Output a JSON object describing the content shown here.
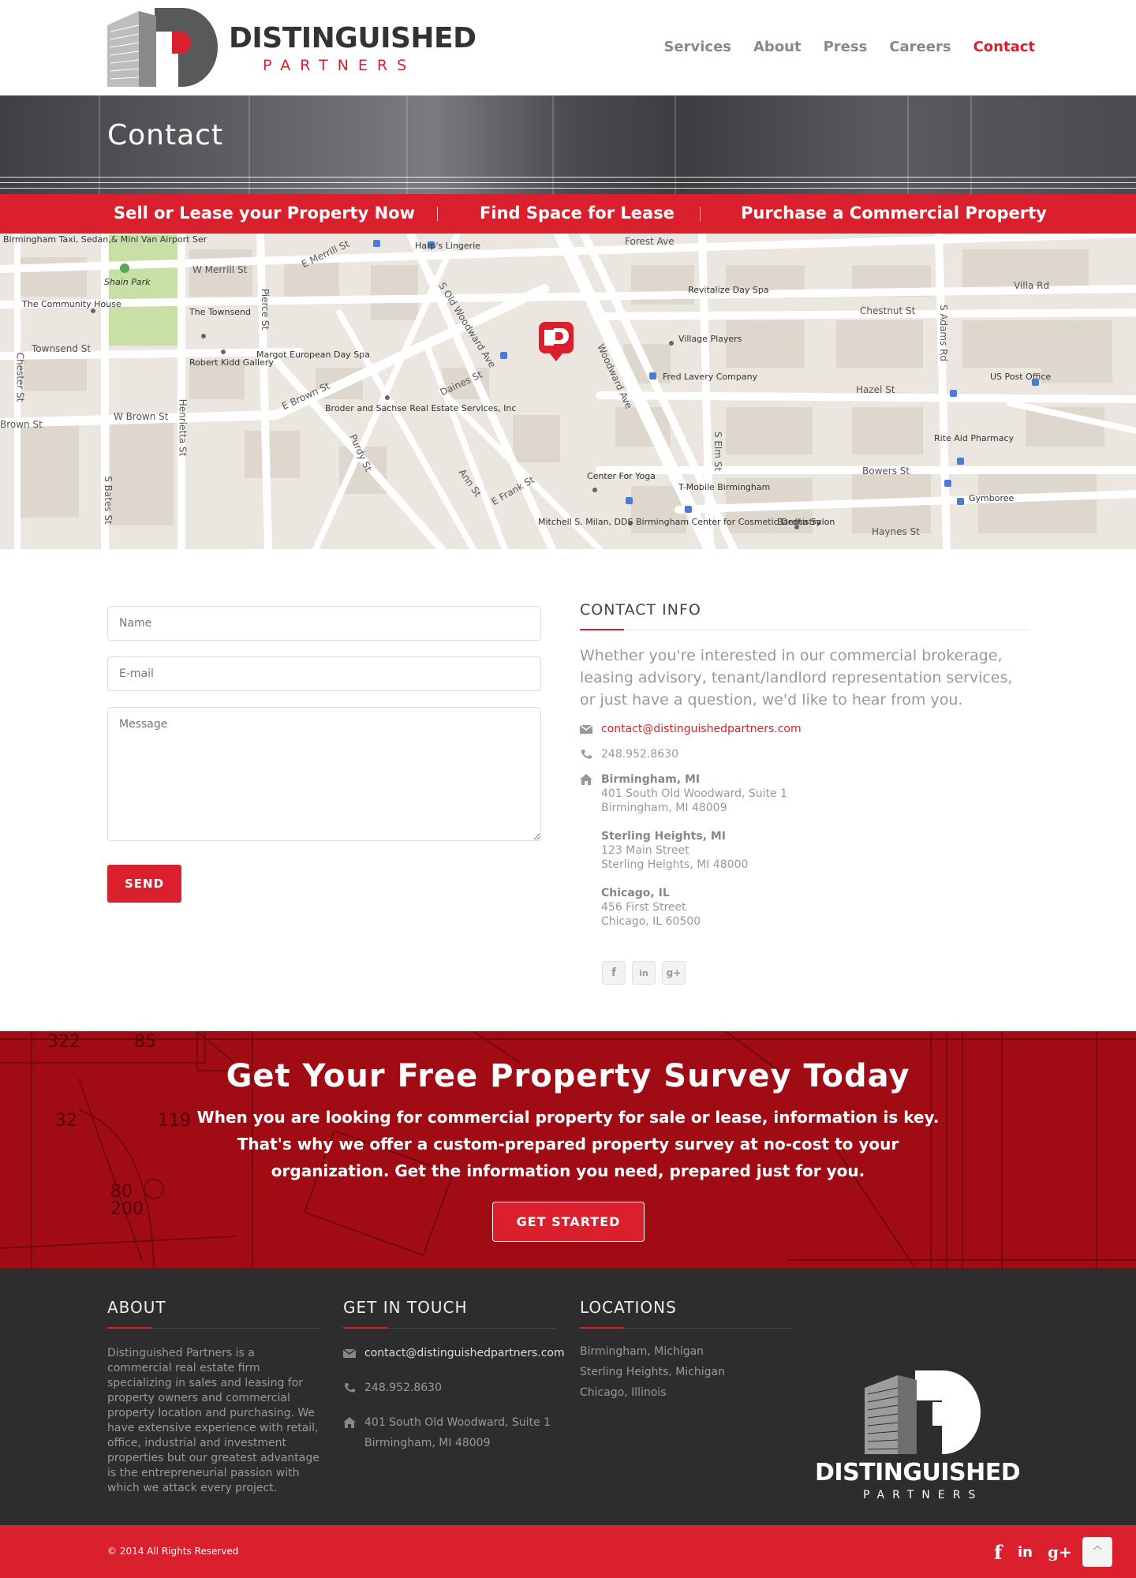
{
  "brand": {
    "name_line1": "DISTINGUISHED",
    "name_line2": "PARTNERS",
    "accent_color": "#d9202c",
    "dark_color": "#2d2d2e"
  },
  "nav": {
    "items": [
      {
        "label": "Services",
        "active": false
      },
      {
        "label": "About",
        "active": false
      },
      {
        "label": "Press",
        "active": false
      },
      {
        "label": "Careers",
        "active": false
      },
      {
        "label": "Contact",
        "active": true
      }
    ]
  },
  "hero": {
    "title": "Contact"
  },
  "redbar": {
    "items": [
      "Sell or Lease your Property Now",
      "Find Space for Lease",
      "Purchase a Commercial Property"
    ]
  },
  "map": {
    "labels": {
      "birmingham_taxi": "Birmingham Taxi, Sedan,& Mini Van Airport Ser",
      "shain_park": "Shain Park",
      "community_house": "The Community House",
      "townsend_hotel": "The Townsend",
      "robert_kidd": "Robert Kidd Gallery",
      "margot": "Margot European Day Spa",
      "harps": "Harp's Lingerie",
      "revitalize": "Revitalize Day Spa",
      "village_players": "Village Players",
      "fred_lavery": "Fred Lavery Company",
      "broder": "Broder and Sachse Real Estate Services, Inc",
      "center_yoga": "Center For Yoga",
      "tmobile": "T-Mobile Birmingham",
      "mitchell": "Mitchell S. Milan, DDS Birmingham Center for Cosmetic Dentistry",
      "bardha": "Bardha Salon",
      "rite_aid": "Rite Aid Pharmacy",
      "us_post": "US Post Office",
      "gymboree": "Gymboree",
      "forest_ave": "Forest Ave",
      "villa_rd": "Villa Rd",
      "chestnut_st": "Chestnut St",
      "hazel_st": "Hazel St",
      "bowers_st": "Bowers St",
      "haynes_st": "Haynes St",
      "townsend_st": "Townsend St",
      "w_brown_st": "W Brown St",
      "brown_st": "Brown St",
      "e_brown_st": "E Brown St",
      "w_merrill_st": "W Merrill St",
      "e_merrill_st": "E Merrill St",
      "woodward_ave": "Woodward Ave",
      "s_old_woodward": "S Old Woodward Ave",
      "pierce_st": "Pierce St",
      "henrietta_st": "Henrietta St",
      "s_bates_st": "S Bates St",
      "chester_st": "Chester St",
      "s_adams_rd": "S Adams Rd",
      "s_elm_st": "S Elm St",
      "daines_st": "Daines St",
      "purdy_st": "Purdy St",
      "ann_st": "Ann St",
      "e_frank_st": "E Frank St"
    }
  },
  "form": {
    "name_placeholder": "Name",
    "email_placeholder": "E-mail",
    "message_placeholder": "Message",
    "send_label": "SEND"
  },
  "contact_info": {
    "title": "CONTACT INFO",
    "intro": "Whether you're interested in our commercial brokerage, leasing advisory, tenant/landlord representation services, or just have a question, we'd like to hear from you.",
    "email": "contact@distinguishedpartners.com",
    "phone": "248.952.8630",
    "locations": [
      {
        "name": "Birmingham, MI",
        "line1": "401 South Old Woodward, Suite 1",
        "line2": "Birmingham, MI 48009"
      },
      {
        "name": "Sterling Heights, MI",
        "line1": "123 Main Street",
        "line2": "Sterling Heights, MI 48000"
      },
      {
        "name": "Chicago, IL",
        "line1": "456 First Street",
        "line2": "Chicago, IL 60500"
      }
    ],
    "social": [
      "f",
      "in",
      "g+"
    ]
  },
  "survey": {
    "title": "Get Your Free Property Survey Today",
    "body": "When you are looking for commercial property for sale or lease, information is key. That's why we offer a custom-prepared property survey at no-cost to your organization. Get the information you need, prepared just for you.",
    "button": "GET STARTED"
  },
  "footer": {
    "about_title": "ABOUT",
    "about_text": "Distinguished Partners is a commercial real estate firm specializing in sales and leasing for property owners and commercial property location and purchasing. We have extensive experience with retail, office, industrial and investment properties but our greatest advantage is the entrepreneurial passion with which we attack every project.",
    "touch_title": "GET IN TOUCH",
    "email": "contact@distinguishedpartners.com",
    "phone": "248.952.8630",
    "address_line1": "401 South Old Woodward, Suite 1",
    "address_line2": "Birmingham, MI 48009",
    "locations_title": "LOCATIONS",
    "locations": [
      "Birmingham, Michigan",
      "Sterling Heights, Michigan",
      "Chicago, Illinois"
    ]
  },
  "bottom": {
    "copyright": "© 2014 All Rights Reserved",
    "social": [
      "f",
      "in",
      "g+"
    ],
    "to_top": "^"
  }
}
